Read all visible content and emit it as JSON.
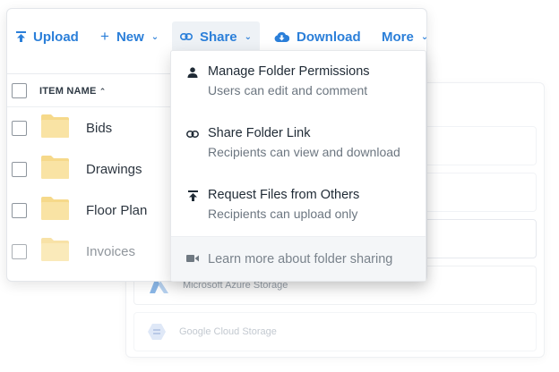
{
  "toolbar": {
    "upload_label": "Upload",
    "new_label": "New",
    "share_label": "Share",
    "download_label": "Download",
    "more_label": "More"
  },
  "file_list": {
    "header_label": "ITEM NAME",
    "items": [
      {
        "name": "Bids"
      },
      {
        "name": "Drawings"
      },
      {
        "name": "Floor Plan"
      },
      {
        "name": "Invoices"
      }
    ]
  },
  "share_menu": {
    "items": [
      {
        "title": "Manage Folder Permissions",
        "subtitle": "Users can edit and comment",
        "icon": "person-icon"
      },
      {
        "title": "Share Folder Link",
        "subtitle": "Recipients can view and download",
        "icon": "link-icon"
      },
      {
        "title": "Request Files from Others",
        "subtitle": "Recipients can upload only",
        "icon": "upload-icon"
      }
    ],
    "footer_label": "Learn more about folder sharing",
    "footer_icon": "video-icon"
  },
  "background_panel": {
    "azure_label": "Microsoft Azure Storage",
    "gcs_label": "Google Cloud Storage"
  },
  "colors": {
    "accent": "#2b7fd9",
    "folder": "#f6d98a",
    "text": "#1f2a35"
  }
}
